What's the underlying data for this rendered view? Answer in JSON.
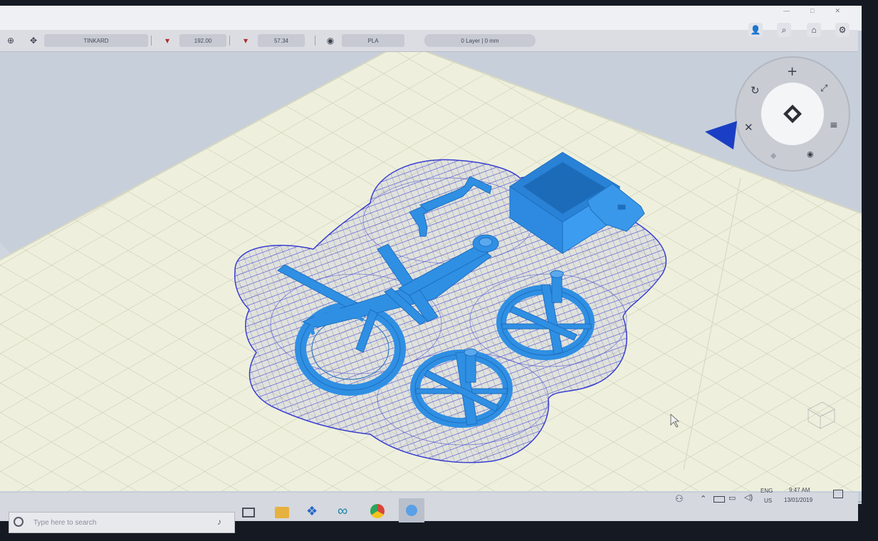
{
  "toolbar": {
    "printer_name": "TINKARD",
    "nozzle_temp": "192.00",
    "bed_temp": "57.34",
    "material": "PLA",
    "layer_info": "0 Layer | 0 mm"
  },
  "taskbar": {
    "search_placeholder": "Type here to search",
    "language": "ENG",
    "region": "US",
    "time": "9:47 AM",
    "date": "13/01/2019"
  },
  "colors": {
    "bed": "#eef0dd",
    "grid": "#c9cab2",
    "model": "#2f8fe3",
    "support": "#3a3fd0"
  }
}
